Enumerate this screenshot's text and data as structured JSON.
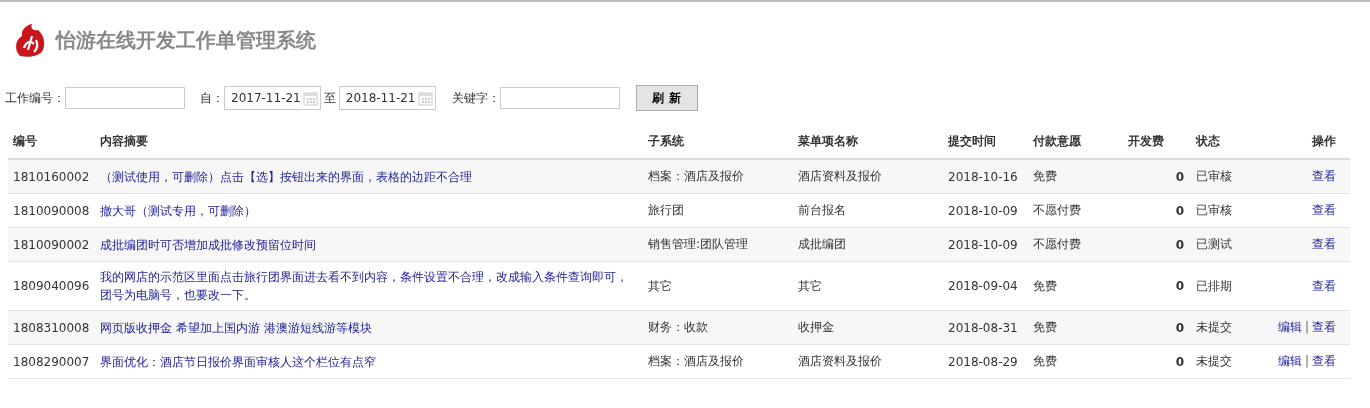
{
  "title": "怡游在线开发工作单管理系统",
  "filters": {
    "work_no_label": "工作编号：",
    "from_label": "自：",
    "from_date": "2017-11-21",
    "to_label": "至",
    "to_date": "2018-11-21",
    "keyword_label": "关键字：",
    "refresh_button": "刷 新"
  },
  "table": {
    "columns": [
      "编号",
      "内容摘要",
      "子系统",
      "菜单项名称",
      "提交时间",
      "付款意愿",
      "开发费",
      "状态",
      "操作"
    ],
    "rows": [
      {
        "id": "1810160002",
        "summary": "（测试使用，可删除）点击【选】按钮出来的界面，表格的边距不合理",
        "subsystem": "档案：酒店及报价",
        "menu": "酒店资料及报价",
        "time": "2018-10-16",
        "payment": "免费",
        "fee": "0",
        "status": "已审核",
        "actions": [
          {
            "kind": "link",
            "text": "查看"
          }
        ]
      },
      {
        "id": "1810090008",
        "summary": "撤大哥（测试专用，可删除）",
        "subsystem": "旅行团",
        "menu": "前台报名",
        "time": "2018-10-09",
        "payment": "不愿付费",
        "fee": "0",
        "status": "已审核",
        "actions": [
          {
            "kind": "link",
            "text": "查看"
          }
        ]
      },
      {
        "id": "1810090002",
        "summary": "成批编团时可否增加成批修改预留位时间",
        "subsystem": "销售管理:团队管理",
        "menu": "成批编团",
        "time": "2018-10-09",
        "payment": "不愿付费",
        "fee": "0",
        "status": "已测试",
        "actions": [
          {
            "kind": "link",
            "text": "查看"
          }
        ]
      },
      {
        "id": "1809040096",
        "summary": "我的网店的示范区里面点击旅行团界面进去看不到内容，条件设置不合理，改成输入条件查询即可，团号为电脑号，也要改一下。",
        "subsystem": "其它",
        "menu": "其它",
        "time": "2018-09-04",
        "payment": "免费",
        "fee": "0",
        "status": "已排期",
        "actions": [
          {
            "kind": "link",
            "text": "查看"
          }
        ]
      },
      {
        "id": "1808310008",
        "summary": "网页版收押金 希望加上国内游 港澳游短线游等模块",
        "subsystem": "财务：收款",
        "menu": "收押金",
        "time": "2018-08-31",
        "payment": "免费",
        "fee": "0",
        "status": "未提交",
        "actions": [
          {
            "kind": "link",
            "text": "编辑"
          },
          {
            "kind": "separator",
            "text": "|"
          },
          {
            "kind": "link",
            "text": "查看"
          }
        ]
      },
      {
        "id": "1808290007",
        "summary": "界面优化：酒店节日报价界面审核人这个栏位有点窄",
        "subsystem": "档案：酒店及报价",
        "menu": "酒店资料及报价",
        "time": "2018-08-29",
        "payment": "免费",
        "fee": "0",
        "status": "未提交",
        "actions": [
          {
            "kind": "link",
            "text": "编辑"
          },
          {
            "kind": "separator",
            "text": "|"
          },
          {
            "kind": "link",
            "text": "查看"
          }
        ]
      }
    ]
  }
}
